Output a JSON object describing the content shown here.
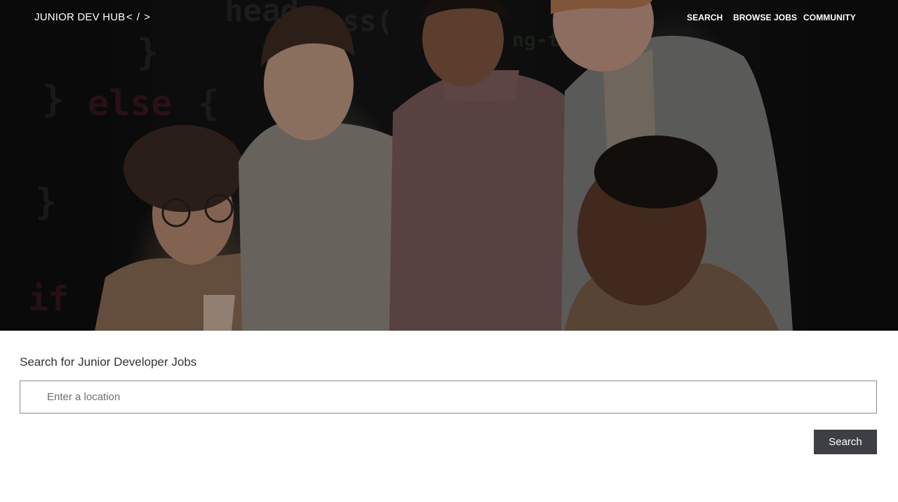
{
  "nav": {
    "logo": "JUNIOR DEV HUB",
    "logo_mark": "< / >",
    "links": [
      {
        "label": "SEARCH"
      },
      {
        "label": "BROWSE JOBS"
      },
      {
        "label": "COMMUNITY"
      }
    ]
  },
  "hero": {
    "image": "hero-photo-team-around-laptop"
  },
  "search": {
    "heading": "Search for Junior Developer Jobs",
    "location_placeholder": "Enter a location",
    "location_value": "",
    "button_label": "Search"
  },
  "colors": {
    "button_bg": "#3d3f45",
    "input_border": "#8c8c8c",
    "text": "#333333"
  }
}
